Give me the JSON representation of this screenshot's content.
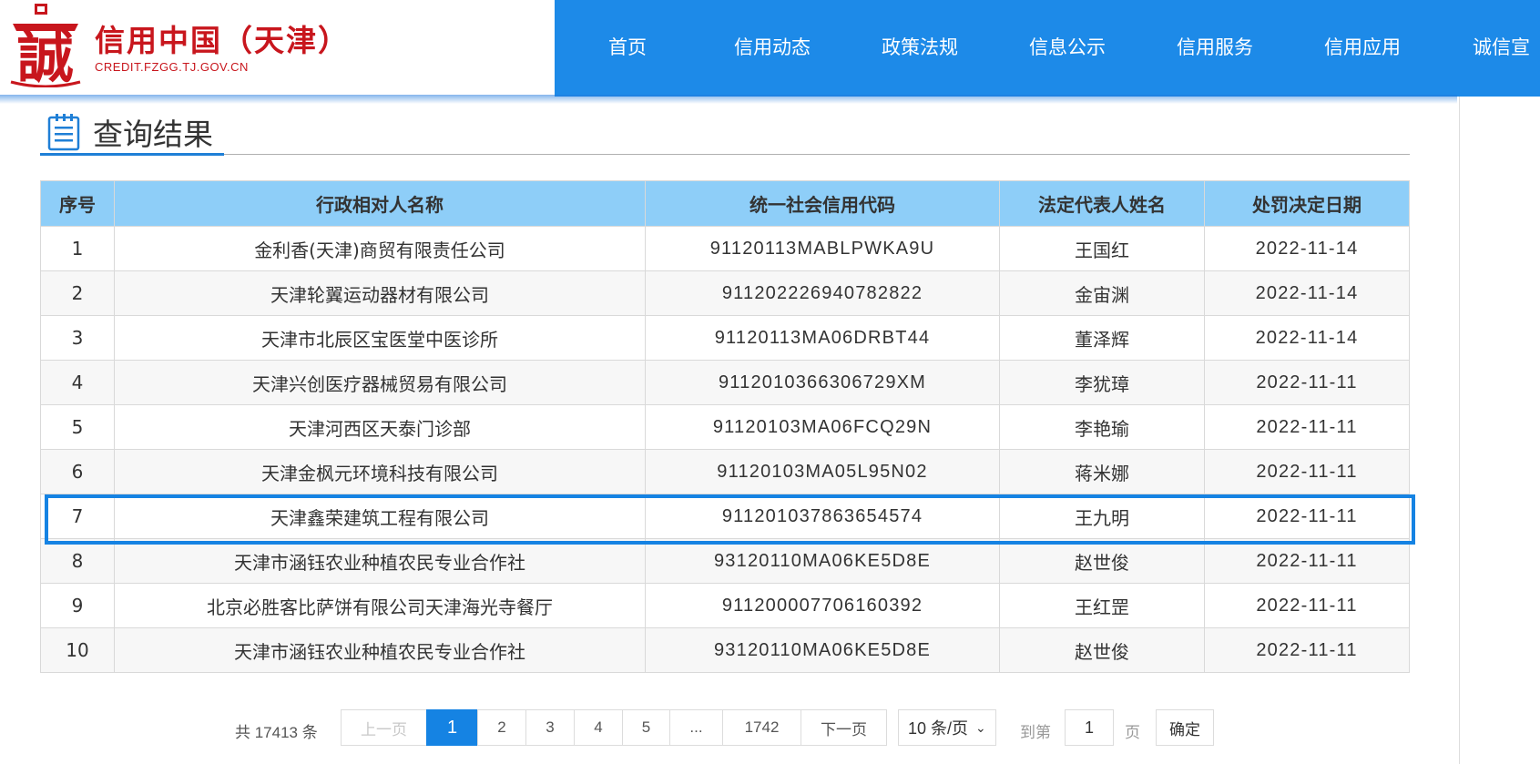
{
  "header": {
    "site_name": "信用中国（天津）",
    "site_domain": "CREDIT.FZGG.TJ.GOV.CN",
    "logo_glyph": "誠",
    "brand_color": "#c8161d",
    "nav_color": "#1d8ae8",
    "nav": [
      "首页",
      "信用动态",
      "政策法规",
      "信息公示",
      "信用服务",
      "信用应用",
      "诚信宣"
    ]
  },
  "section": {
    "title": "查询结果"
  },
  "table": {
    "headers": [
      "序号",
      "行政相对人名称",
      "统一社会信用代码",
      "法定代表人姓名",
      "处罚决定日期"
    ],
    "rows": [
      {
        "no": "1",
        "name": "金利香(天津)商贸有限责任公司",
        "code": "91120113MABLPWKA9U",
        "rep": "王国红",
        "date": "2022-11-14"
      },
      {
        "no": "2",
        "name": "天津轮翼运动器材有限公司",
        "code": "911202226940782822",
        "rep": "金宙渊",
        "date": "2022-11-14"
      },
      {
        "no": "3",
        "name": "天津市北辰区宝医堂中医诊所",
        "code": "91120113MA06DRBT44",
        "rep": "董泽辉",
        "date": "2022-11-14"
      },
      {
        "no": "4",
        "name": "天津兴创医疗器械贸易有限公司",
        "code": "911201036630672 9XM",
        "rep": "李犹璋",
        "date": "2022-11-11"
      },
      {
        "no": "5",
        "name": "天津河西区天泰门诊部",
        "code": "91120103MA06FCQ29N",
        "rep": "李艳瑜",
        "date": "2022-11-11"
      },
      {
        "no": "6",
        "name": "天津金枫元环境科技有限公司",
        "code": "91120103MA05L95N02",
        "rep": "蒋米娜",
        "date": "2022-11-11"
      },
      {
        "no": "7",
        "name": "天津鑫荣建筑工程有限公司",
        "code": "911201037863654574",
        "rep": "王九明",
        "date": "2022-11-11"
      },
      {
        "no": "8",
        "name": "天津市涵钰农业种植农民专业合作社",
        "code": "93120110MA06KE5D8E",
        "rep": "赵世俊",
        "date": "2022-11-11"
      },
      {
        "no": "9",
        "name": "北京必胜客比萨饼有限公司天津海光寺餐厅",
        "code": "911200007706160392",
        "rep": "王红罡",
        "date": "2022-11-11"
      },
      {
        "no": "10",
        "name": "天津市涵钰农业种植农民专业合作社",
        "code": "93120110MA06KE5D8E",
        "rep": "赵世俊",
        "date": "2022-11-11"
      }
    ]
  },
  "pagination": {
    "total_text": "共 17413 条",
    "prev": "上一页",
    "pages": [
      "1",
      "2",
      "3",
      "4",
      "5",
      "...",
      "1742"
    ],
    "current": "1",
    "next": "下一页",
    "page_size": "10 条/页",
    "goto_prefix": "到第",
    "goto_value": "1",
    "goto_suffix": "页",
    "confirm": "确定"
  }
}
